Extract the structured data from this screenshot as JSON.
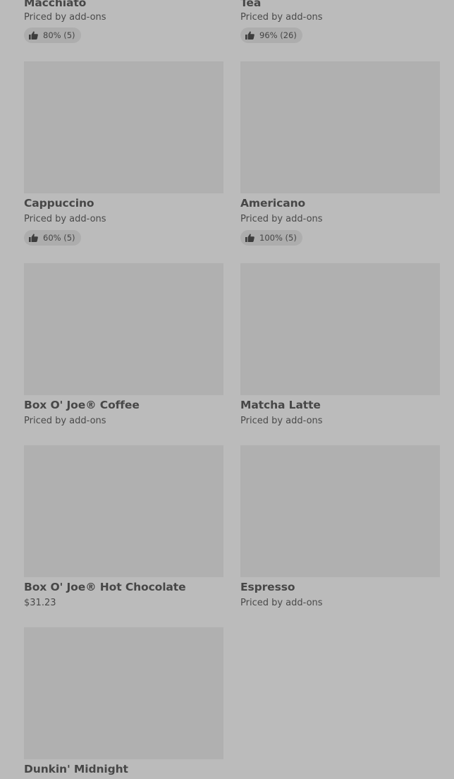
{
  "menu_items": [
    {
      "name": "Macchiato",
      "price": "Priced by add-ons",
      "rating": "80% (5)"
    },
    {
      "name": "Tea",
      "price": "Priced by add-ons",
      "rating": "96% (26)"
    },
    {
      "name": "Cappuccino",
      "price": "Priced by add-ons",
      "rating": "60% (5)"
    },
    {
      "name": "Americano",
      "price": "Priced by add-ons",
      "rating": "100% (5)"
    },
    {
      "name": "Box O' Joe® Coffee",
      "price": "Priced by add-ons"
    },
    {
      "name": "Matcha Latte",
      "price": "Priced by add-ons"
    },
    {
      "name": "Box O' Joe® Hot Chocolate",
      "price": "$31.23"
    },
    {
      "name": "Espresso",
      "price": "Priced by add-ons"
    },
    {
      "name": "Dunkin' Midnight"
    }
  ],
  "icons": {
    "rating": "thumbs-up-icon"
  },
  "colors": {
    "background": "#bbbbbb",
    "image_placeholder": "#b0b0b0",
    "rating_pill": "#adadad",
    "text": "#484848"
  }
}
